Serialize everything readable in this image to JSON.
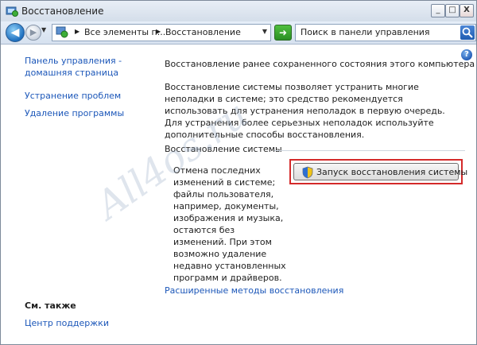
{
  "window": {
    "title": "Восстановление",
    "controls": {
      "minimize": "_",
      "maximize": "□",
      "close": "X"
    }
  },
  "navigation": {
    "back_icon": "back-arrow-icon",
    "forward_icon": "forward-arrow-icon",
    "address": {
      "segments": [
        "Все элементы п...",
        "Восстановление"
      ]
    },
    "search": {
      "placeholder": "Поиск в панели управления"
    }
  },
  "sidebar": {
    "links": [
      {
        "label": "Панель управления -"
      },
      {
        "label": "домашняя страница"
      },
      {
        "label": "Устранение проблем"
      },
      {
        "label": "Удаление программы"
      }
    ],
    "see_also_title": "См. также",
    "see_also_links": [
      {
        "label": "Центр поддержки"
      }
    ]
  },
  "main": {
    "title": "Восстановление ранее сохраненного состояния этого компьютера",
    "description": "Восстановление системы позволяет устранить многие неполадки в системе; это средство рекомендуется использовать для устранения неполадок в первую очередь. Для устранения более серьезных неполадок используйте дополнительные способы восстановления.",
    "section": {
      "title": "Восстановление системы",
      "description": "Отмена последних изменений в системе; файлы пользователя, например, документы, изображения и музыка, остаются без изменений. При этом возможно удаление недавно установленных программ и драйверов.",
      "button_label": "Запуск восстановления системы"
    },
    "advanced_link": "Расширенные методы восстановления"
  },
  "watermark": "All4os.ru",
  "colors": {
    "link": "#1c57b9",
    "highlight": "#d42a2a"
  }
}
